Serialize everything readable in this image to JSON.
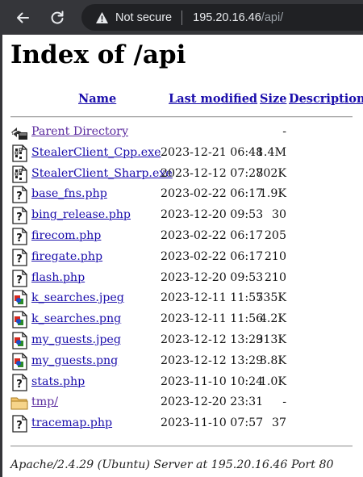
{
  "browser": {
    "security_label": "Not secure",
    "url_host": "195.20.16.46",
    "url_path": "/api/",
    "icons": {
      "back": "back-arrow-icon",
      "reload": "reload-icon",
      "security": "warning-triangle-icon"
    }
  },
  "page": {
    "title": "Index of /api",
    "columns": {
      "name": "Name",
      "last_modified": "Last modified",
      "size": "Size",
      "description": "Description"
    },
    "entries": [
      {
        "name": "Parent Directory",
        "date": "",
        "size": "-",
        "icon": "back-folder-icon",
        "kind": "parent"
      },
      {
        "name": "StealerClient_Cpp.exe",
        "date": "2023-12-21 06:48",
        "size": "1.4M",
        "icon": "binary-file-icon",
        "kind": "binary"
      },
      {
        "name": "StealerClient_Sharp.exe",
        "date": "2023-12-12 07:27",
        "size": "802K",
        "icon": "binary-file-icon",
        "kind": "binary"
      },
      {
        "name": "base_fns.php",
        "date": "2023-02-22 06:17",
        "size": "1.9K",
        "icon": "unknown-file-icon",
        "kind": "unknown"
      },
      {
        "name": "bing_release.php",
        "date": "2023-12-20 09:53",
        "size": "30",
        "icon": "unknown-file-icon",
        "kind": "unknown"
      },
      {
        "name": "firecom.php",
        "date": "2023-02-22 06:17",
        "size": "205",
        "icon": "unknown-file-icon",
        "kind": "unknown"
      },
      {
        "name": "firegate.php",
        "date": "2023-02-22 06:17",
        "size": "210",
        "icon": "unknown-file-icon",
        "kind": "unknown"
      },
      {
        "name": "flash.php",
        "date": "2023-12-20 09:53",
        "size": "210",
        "icon": "unknown-file-icon",
        "kind": "unknown"
      },
      {
        "name": "k_searches.jpeg",
        "date": "2023-12-11 11:57",
        "size": "535K",
        "icon": "image-file-icon",
        "kind": "image"
      },
      {
        "name": "k_searches.png",
        "date": "2023-12-11 11:56",
        "size": "4.2K",
        "icon": "image-file-icon",
        "kind": "image"
      },
      {
        "name": "my_guests.jpeg",
        "date": "2023-12-12 13:29",
        "size": "313K",
        "icon": "image-file-icon",
        "kind": "image"
      },
      {
        "name": "my_guests.png",
        "date": "2023-12-12 13:29",
        "size": "3.8K",
        "icon": "image-file-icon",
        "kind": "image"
      },
      {
        "name": "stats.php",
        "date": "2023-11-10 10:24",
        "size": "1.0K",
        "icon": "unknown-file-icon",
        "kind": "unknown"
      },
      {
        "name": "tmp/",
        "date": "2023-12-20 23:31",
        "size": "-",
        "icon": "folder-icon",
        "kind": "folder"
      },
      {
        "name": "tracemap.php",
        "date": "2023-11-10 07:57",
        "size": "37",
        "icon": "unknown-file-icon",
        "kind": "unknown"
      }
    ],
    "footer": "Apache/2.4.29 (Ubuntu) Server at 195.20.16.46 Port 80"
  }
}
